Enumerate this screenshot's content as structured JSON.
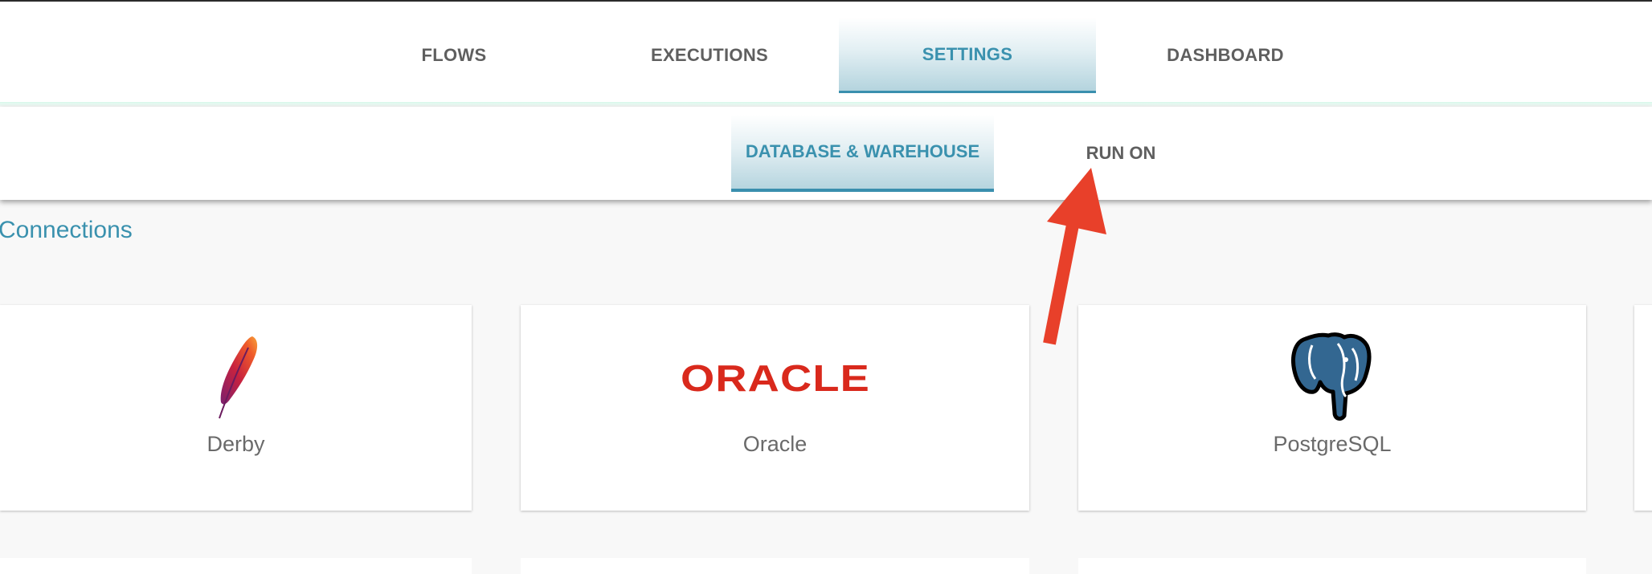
{
  "main_nav": {
    "tabs": [
      {
        "label": "FLOWS"
      },
      {
        "label": "EXECUTIONS"
      },
      {
        "label": "SETTINGS",
        "active": true
      },
      {
        "label": "DASHBOARD"
      }
    ]
  },
  "sub_nav": {
    "tabs": [
      {
        "label": "DATABASE & WAREHOUSE",
        "active": true
      },
      {
        "label": "RUN ON"
      }
    ]
  },
  "section": {
    "title": "Connections"
  },
  "connections": [
    {
      "label": "Derby",
      "icon": "apache-feather-icon"
    },
    {
      "label": "Oracle",
      "icon": "oracle-logo",
      "logo_text": "ORACLE"
    },
    {
      "label": "PostgreSQL",
      "icon": "postgresql-elephant-icon"
    }
  ],
  "colors": {
    "accent": "#3a91ae",
    "arrow": "#e8402a",
    "oracle_red": "#d9291c",
    "postgres_blue": "#336791"
  }
}
